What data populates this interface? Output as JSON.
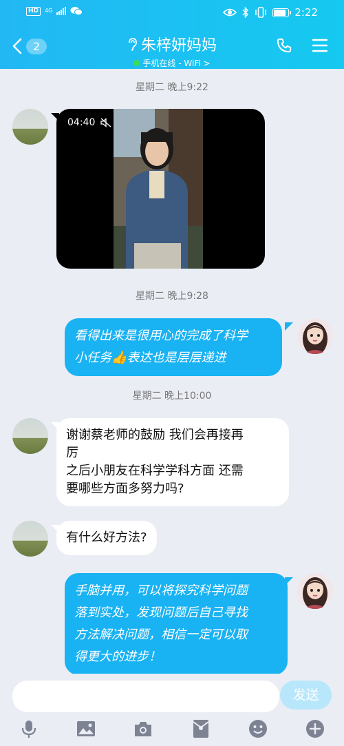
{
  "status_bar": {
    "hd_label": "HD",
    "network_label": "4G",
    "time": "2:22"
  },
  "header": {
    "back_count": "2",
    "title": "朱梓妍妈妈",
    "subtitle": "手机在线 - WiFi >"
  },
  "messages": [
    {
      "type": "timestamp",
      "text": "星期二 晚上9:22"
    },
    {
      "type": "video",
      "side": "left",
      "duration": "04:40"
    },
    {
      "type": "timestamp",
      "text": "星期二 晚上9:28"
    },
    {
      "type": "text",
      "side": "right",
      "lines": [
        "看得出来是很用心的完成了科学",
        "小任务👍表达也是层层递进"
      ]
    },
    {
      "type": "timestamp",
      "text": "星期二 晚上10:00"
    },
    {
      "type": "text",
      "side": "left",
      "lines": [
        "谢谢蔡老师的鼓励 我们会再接再",
        "厉",
        "之后小朋友在科学学科方面 还需",
        "要哪些方面多努力吗?"
      ]
    },
    {
      "type": "text",
      "side": "left",
      "lines": [
        "有什么好方法?"
      ]
    },
    {
      "type": "text",
      "side": "right",
      "lines": [
        "手脑并用，可以将探究科学问题",
        "落到实处，发现问题后自己寻找",
        "方法解决问题，相信一定可以取",
        "得更大的进步！"
      ]
    }
  ],
  "input_bar": {
    "send_label": "发送",
    "toolbar_icons": [
      "microphone-icon",
      "image-icon",
      "camera-icon",
      "red-packet-icon",
      "emoji-icon",
      "plus-icon"
    ]
  },
  "colors": {
    "header_gradient_start": "#22b8f4",
    "header_gradient_end": "#15c9f0",
    "bubble_blue": "#19b2f3",
    "chat_background": "#eaedf4",
    "send_button": "#b8e7fb",
    "online_dot": "#3ddc52"
  }
}
